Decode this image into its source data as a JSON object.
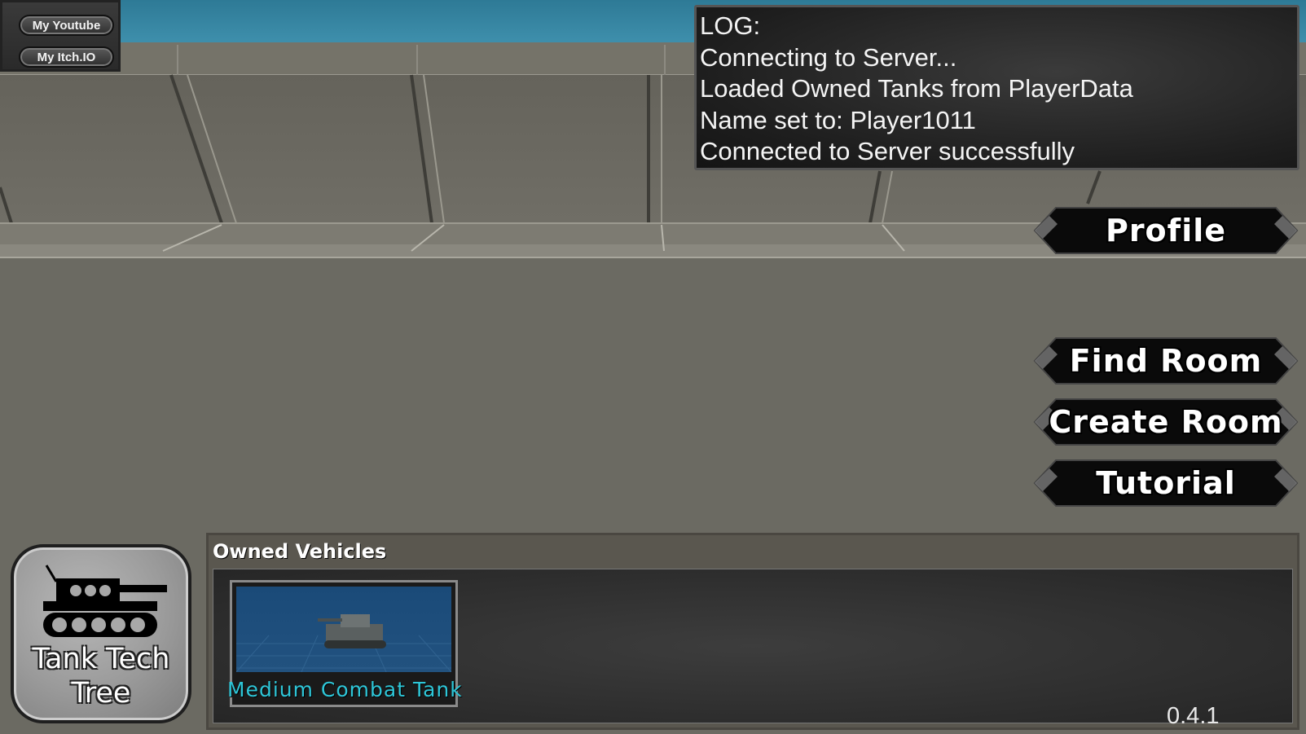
{
  "links": {
    "youtube_label": "My Youtube",
    "itch_label": "My Itch.IO"
  },
  "log": {
    "lines": [
      "LOG:",
      "Connecting to Server...",
      "Loaded Owned Tanks from PlayerData",
      "Name set to: Player1011",
      "Connected to Server successfully"
    ]
  },
  "menu": {
    "profile": "Profile",
    "find_room": "Find Room",
    "create_room": "Create Room",
    "tutorial": "Tutorial"
  },
  "tech_tree": {
    "label_line1": "Tank Tech",
    "label_line2": "Tree",
    "icon": "tank-silhouette-icon"
  },
  "owned_vehicles": {
    "title": "Owned Vehicles",
    "vehicles": [
      {
        "name": "Medium Combat Tank"
      }
    ]
  },
  "version": "0.4.1",
  "colors": {
    "sky": "#3a8aa8",
    "wall": "#6e6c64",
    "floor": "#6b6a62",
    "vehicle_name": "#2ec6d8"
  }
}
